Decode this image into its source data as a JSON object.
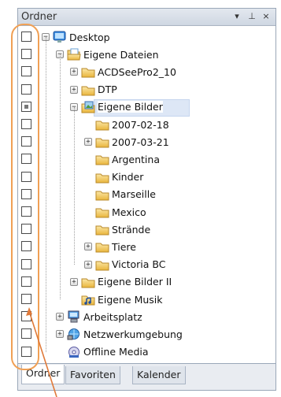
{
  "panel": {
    "title": "Ordner",
    "buttons": {
      "dropdown": "▾",
      "pin": "⊥",
      "close": "×"
    }
  },
  "tree": {
    "items": [
      {
        "label": "Desktop",
        "icon": "desktop-icon",
        "expander": "−",
        "checkbox": "unchecked"
      },
      {
        "label": "Eigene Dateien",
        "icon": "folder-open-icon",
        "expander": "−",
        "checkbox": "unchecked"
      },
      {
        "label": "ACDSeePro2_10",
        "icon": "folder-icon",
        "expander": "+",
        "checkbox": "unchecked"
      },
      {
        "label": "DTP",
        "icon": "folder-icon",
        "expander": "+",
        "checkbox": "unchecked"
      },
      {
        "label": "Eigene Bilder",
        "icon": "pictures-folder-icon",
        "expander": "−",
        "checkbox": "partial",
        "selected": true
      },
      {
        "label": "2007-02-18",
        "icon": "folder-icon",
        "expander": "",
        "checkbox": "unchecked"
      },
      {
        "label": "2007-03-21",
        "icon": "folder-icon",
        "expander": "+",
        "checkbox": "unchecked"
      },
      {
        "label": "Argentina",
        "icon": "folder-icon",
        "expander": "",
        "checkbox": "unchecked"
      },
      {
        "label": "Kinder",
        "icon": "folder-icon",
        "expander": "",
        "checkbox": "unchecked"
      },
      {
        "label": "Marseille",
        "icon": "folder-icon",
        "expander": "",
        "checkbox": "unchecked"
      },
      {
        "label": "Mexico",
        "icon": "folder-icon",
        "expander": "",
        "checkbox": "unchecked"
      },
      {
        "label": "Strände",
        "icon": "folder-icon",
        "expander": "",
        "checkbox": "unchecked"
      },
      {
        "label": "Tiere",
        "icon": "folder-icon",
        "expander": "+",
        "checkbox": "unchecked"
      },
      {
        "label": "Victoria BC",
        "icon": "folder-icon",
        "expander": "+",
        "checkbox": "unchecked"
      },
      {
        "label": "Eigene Bilder II",
        "icon": "folder-icon",
        "expander": "+",
        "checkbox": "unchecked"
      },
      {
        "label": "Eigene Musik",
        "icon": "music-folder-icon",
        "expander": "",
        "checkbox": "unchecked"
      },
      {
        "label": "Arbeitsplatz",
        "icon": "computer-icon",
        "expander": "+",
        "checkbox": "unchecked"
      },
      {
        "label": "Netzwerkumgebung",
        "icon": "network-icon",
        "expander": "+",
        "checkbox": "unchecked"
      },
      {
        "label": "Offline Media",
        "icon": "offline-media-icon",
        "expander": "",
        "checkbox": "unchecked"
      }
    ]
  },
  "tabs": [
    {
      "label": "Ordner",
      "active": true
    },
    {
      "label": "Favoriten",
      "active": false
    },
    {
      "label": "Kalender",
      "active": false
    }
  ],
  "colors": {
    "highlight_oval": "#f0a055",
    "arrow": "#e07a3a",
    "selection": "#dde7f6"
  }
}
